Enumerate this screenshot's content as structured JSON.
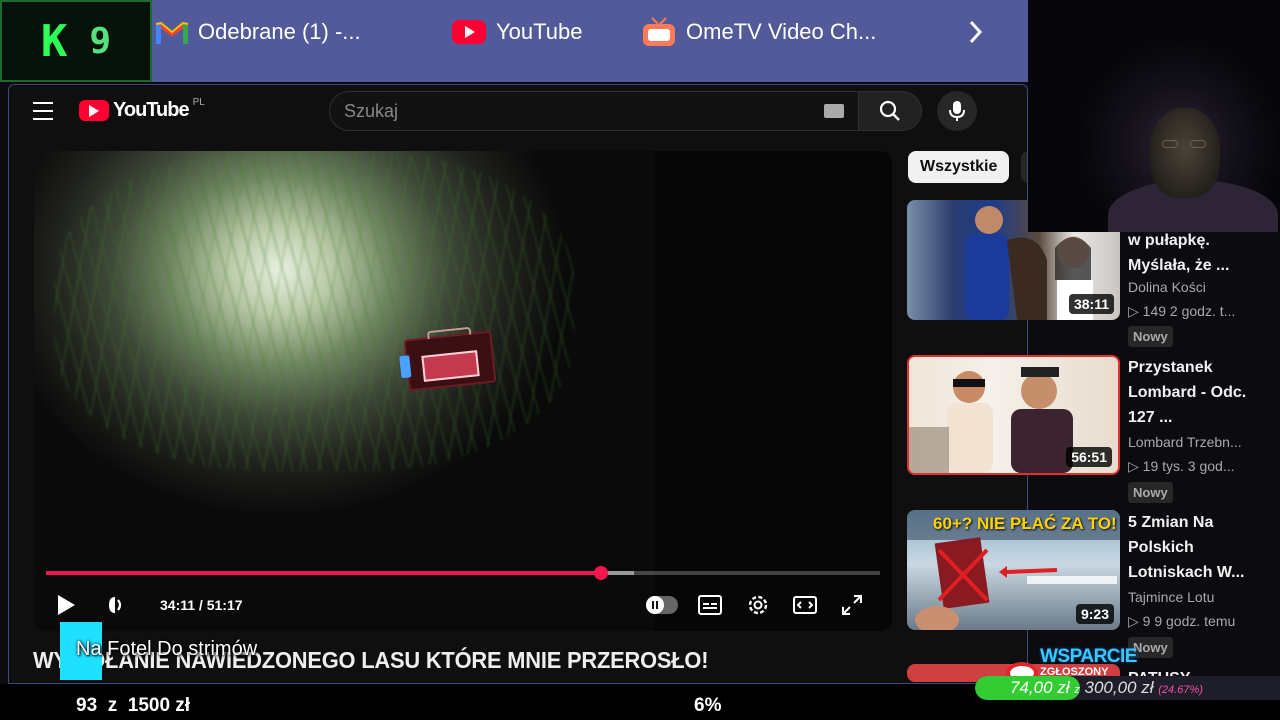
{
  "stream_badge": {
    "left": "K",
    "right": "9"
  },
  "tabs": [
    {
      "label": "Odebrane (1) -...",
      "icon": "gmail-icon"
    },
    {
      "label": "YouTube",
      "icon": "youtube-icon"
    },
    {
      "label": "OmeTV Video Ch...",
      "icon": "ometv-icon"
    }
  ],
  "header": {
    "logo_text": "YouTube",
    "region": "PL",
    "search_placeholder": "Szukaj"
  },
  "player": {
    "time": "34:11 / 51:17",
    "progress_fraction": 0.666,
    "buffer_fraction": 0.705
  },
  "video": {
    "title": "WYWOŁANIE NAWIEDZONEGO LASU KTÓRE MNIE PRZEROSŁO!"
  },
  "filter_chip": "Wszystkie",
  "recommendations": [
    {
      "title_lines": [
        "w pułapkę.",
        "Myślała, że ..."
      ],
      "duration": "38:11",
      "channel": "Dolina Kości",
      "meta": "▷ 149  2 godz. t...",
      "badge": "Nowy"
    },
    {
      "title_lines": [
        "Przystanek",
        "Lombard - Odc.",
        "127 ..."
      ],
      "duration": "56:51",
      "channel": "Lombard Trzebn...",
      "meta": "▷ 19 tys.  3 god...",
      "badge": "Nowy"
    },
    {
      "title_lines": [
        "5 Zmian Na",
        "Polskich",
        "Lotniskach W..."
      ],
      "duration": "9:23",
      "channel": "Tajmince Lotu",
      "meta": "▷ 9  9 godz. temu",
      "badge": "Nowy",
      "thumb_text": "60+? NIE PŁAĆ ZA TO!"
    },
    {
      "title_lines": [
        "PATUSY"
      ],
      "duration": "",
      "channel": "",
      "meta": "",
      "badge": ""
    }
  ],
  "overlay": {
    "fotel_text": "Na Fotel Do strimów",
    "goal_current": "93",
    "goal_sep": "z",
    "goal_target": "1500 zł",
    "goal_percent": "6%",
    "support_title": "WSPARCIE",
    "support_sub": "ZGŁOSZONY",
    "support_current": "74,00 zł",
    "support_z": "z",
    "support_target": "300,00 zł",
    "support_pct": "(24.67%)",
    "support_fraction": 0.2467
  },
  "colors": {
    "accent": "#f0174e",
    "tabbar": "#525a99",
    "badge_cyan": "#1fe0ff",
    "k9_green": "#2dff57"
  }
}
